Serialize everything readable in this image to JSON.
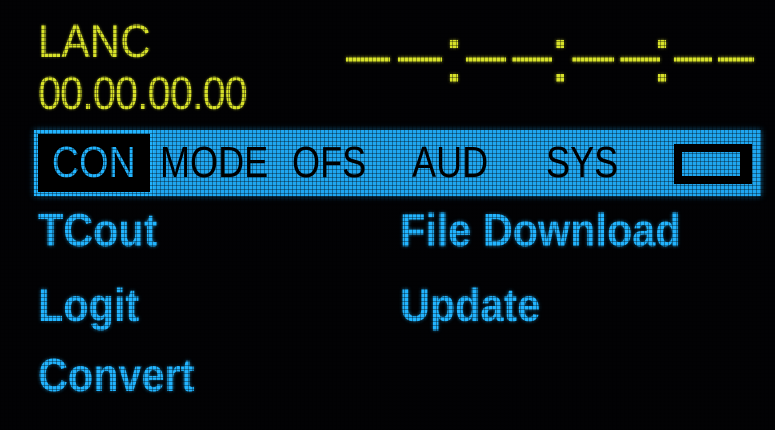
{
  "header": {
    "source_label": "LANC",
    "timecode": "00.00.00.00"
  },
  "tabs": [
    {
      "label": "CON",
      "active": true
    },
    {
      "label": "MODE",
      "active": false
    },
    {
      "label": "OFS",
      "active": false
    },
    {
      "label": "AUD",
      "active": false
    },
    {
      "label": "SYS",
      "active": false
    }
  ],
  "menu": {
    "left": [
      {
        "label": "TCout"
      },
      {
        "label": "Logit"
      },
      {
        "label": "Convert"
      }
    ],
    "right": [
      {
        "label": "File Download"
      },
      {
        "label": "Update"
      }
    ]
  },
  "status": {
    "battery_level": 1.0,
    "battery_icon": "battery-icon"
  },
  "colors": {
    "yellow": "#d6e02a",
    "blue": "#22b4ff",
    "background": "#000000"
  }
}
